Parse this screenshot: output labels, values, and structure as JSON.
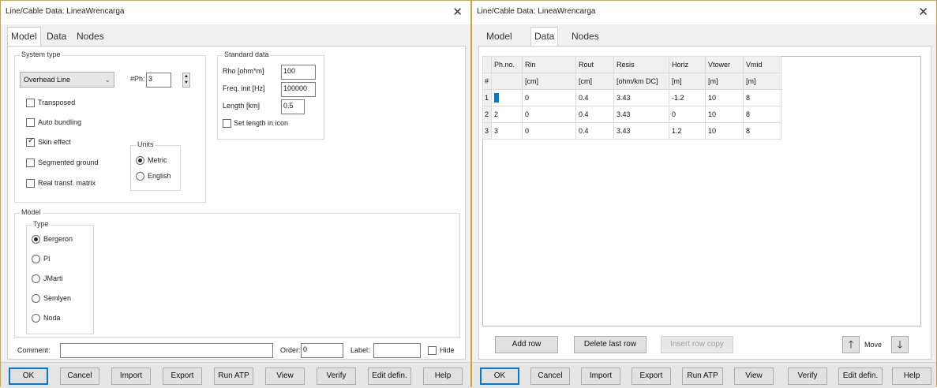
{
  "left": {
    "title": "Line/Cable Data: LineaWrencarga",
    "tabs": [
      "Model",
      "Data",
      "Nodes"
    ],
    "system_type": {
      "label": "System type",
      "select_value": "Overhead Line",
      "nph_label": "#Ph:",
      "nph_value": "3",
      "checks": [
        {
          "label": "Transposed",
          "checked": false
        },
        {
          "label": "Auto bundling",
          "checked": false
        },
        {
          "label": "Skin effect",
          "checked": true
        },
        {
          "label": "Segmented ground",
          "checked": false
        },
        {
          "label": "Real transf. matrix",
          "checked": false
        }
      ],
      "units_label": "Units",
      "units": [
        {
          "label": "Metric",
          "checked": true
        },
        {
          "label": "English",
          "checked": false
        }
      ]
    },
    "standard_data": {
      "label": "Standard data",
      "rho_label": "Rho [ohm*m]",
      "rho_value": "100",
      "freq_label": "Freq. init [Hz]",
      "freq_value": "100000",
      "length_label": "Length [km]",
      "length_value": "0.5",
      "set_length_label": "Set length in icon"
    },
    "model": {
      "label": "Model",
      "type_label": "Type",
      "types": [
        {
          "label": "Bergeron",
          "checked": true
        },
        {
          "label": "PI",
          "checked": false
        },
        {
          "label": "JMarti",
          "checked": false
        },
        {
          "label": "Semlyen",
          "checked": false
        },
        {
          "label": "Noda",
          "checked": false
        }
      ]
    },
    "comment_label": "Comment:",
    "comment_value": "",
    "order_label": "Order:",
    "order_value": "0",
    "label_label": "Label:",
    "label_value": "",
    "hide_label": "Hide",
    "buttons": [
      "OK",
      "Cancel",
      "Import",
      "Export",
      "Run ATP",
      "View",
      "Verify",
      "Edit defin.",
      "Help"
    ]
  },
  "right": {
    "title": "Line/Cable Data: LineaWrencarga",
    "tabs": [
      "Model",
      "Data",
      "Nodes"
    ],
    "table": {
      "columns": [
        "Ph.no.",
        "Rin",
        "Rout",
        "Resis",
        "Horiz",
        "Vtower",
        "Vmid"
      ],
      "units": [
        "",
        "[cm]",
        "[cm]",
        "[ohm/km DC]",
        "[m]",
        "[m]",
        "[m]"
      ],
      "row_header_label": "#",
      "rows": [
        {
          "n": "1",
          "cells": [
            "1",
            "0",
            "0.4",
            "3.43",
            "-1.2",
            "10",
            "8"
          ]
        },
        {
          "n": "2",
          "cells": [
            "2",
            "0",
            "0.4",
            "3.43",
            "0",
            "10",
            "8"
          ]
        },
        {
          "n": "3",
          "cells": [
            "3",
            "0",
            "0.4",
            "3.43",
            "1.2",
            "10",
            "8"
          ]
        }
      ]
    },
    "add_row": "Add row",
    "delete_row": "Delete last row",
    "insert_copy": "Insert row copy",
    "move_label": "Move",
    "buttons": [
      "OK",
      "Cancel",
      "Import",
      "Export",
      "Run ATP",
      "View",
      "Verify",
      "Edit defin.",
      "Help"
    ]
  }
}
